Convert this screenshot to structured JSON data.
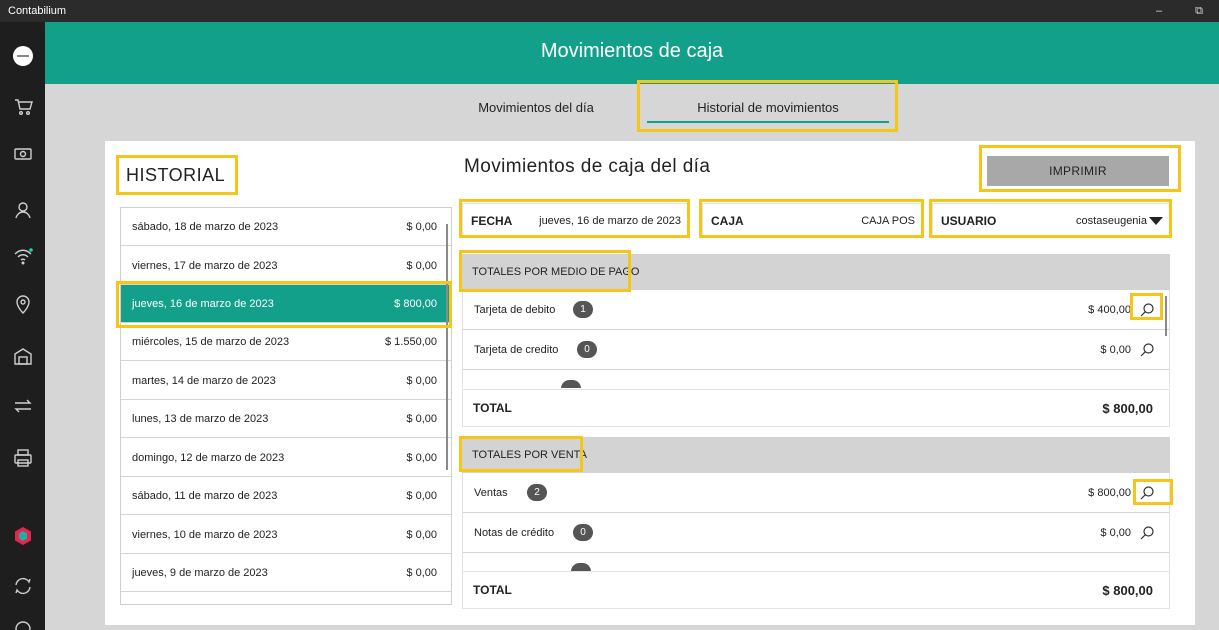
{
  "window": {
    "title": "Contabilium",
    "minimize": "–",
    "restore": "⧉"
  },
  "sidebar": {
    "icons": [
      "logo-icon",
      "cart-icon",
      "money-icon",
      "user-icon",
      "wifi-icon",
      "location-icon",
      "store-icon",
      "transfer-icon",
      "printer-icon",
      "brand-icon",
      "sync-icon",
      "more-icon"
    ]
  },
  "header": {
    "title": "Movimientos de caja"
  },
  "tabs": [
    {
      "label": "Movimientos del día",
      "active": false
    },
    {
      "label": "Historial de movimientos",
      "active": true
    }
  ],
  "history": {
    "title": "HISTORIAL",
    "items": [
      {
        "date": "sábado, 18 de marzo de 2023",
        "amount": "$ 0,00"
      },
      {
        "date": "viernes, 17 de marzo de 2023",
        "amount": "$ 0,00"
      },
      {
        "date": "jueves, 16 de marzo de 2023",
        "amount": "$ 800,00",
        "selected": true
      },
      {
        "date": "miércoles, 15 de marzo de 2023",
        "amount": "$ 1.550,00"
      },
      {
        "date": "martes, 14 de marzo de 2023",
        "amount": "$ 0,00"
      },
      {
        "date": "lunes, 13 de marzo de 2023",
        "amount": "$ 0,00"
      },
      {
        "date": "domingo, 12 de marzo de 2023",
        "amount": "$ 0,00"
      },
      {
        "date": "sábado, 11 de marzo de 2023",
        "amount": "$ 0,00"
      },
      {
        "date": "viernes, 10 de marzo de 2023",
        "amount": "$ 0,00"
      },
      {
        "date": "jueves, 9 de marzo de 2023",
        "amount": "$ 0,00"
      }
    ]
  },
  "detail": {
    "title": "Movimientos de caja del día",
    "print_label": "IMPRIMIR",
    "fecha": {
      "label": "FECHA",
      "value": "jueves, 16 de marzo de 2023"
    },
    "caja": {
      "label": "CAJA",
      "value": "CAJA POS"
    },
    "usuario": {
      "label": "USUARIO",
      "value": "costaseugenia"
    },
    "payment": {
      "title": "TOTALES POR MEDIO DE PAGO",
      "rows": [
        {
          "label": "Tarjeta de debito",
          "count": "1",
          "amount": "$ 400,00"
        },
        {
          "label": "Tarjeta de credito",
          "count": "0",
          "amount": "$ 0,00"
        }
      ],
      "total_label": "TOTAL",
      "total_value": "$ 800,00"
    },
    "sales": {
      "title": "TOTALES POR VENTA",
      "rows": [
        {
          "label": "Ventas",
          "count": "2",
          "amount": "$ 800,00"
        },
        {
          "label": "Notas de crédito",
          "count": "0",
          "amount": "$ 0,00"
        }
      ],
      "total_label": "TOTAL",
      "total_value": "$ 800,00"
    }
  },
  "colors": {
    "accent": "#13a08a",
    "highlight": "#f5c518",
    "sidebar": "#1e1e1e",
    "titlebar": "#2b2b2b"
  }
}
